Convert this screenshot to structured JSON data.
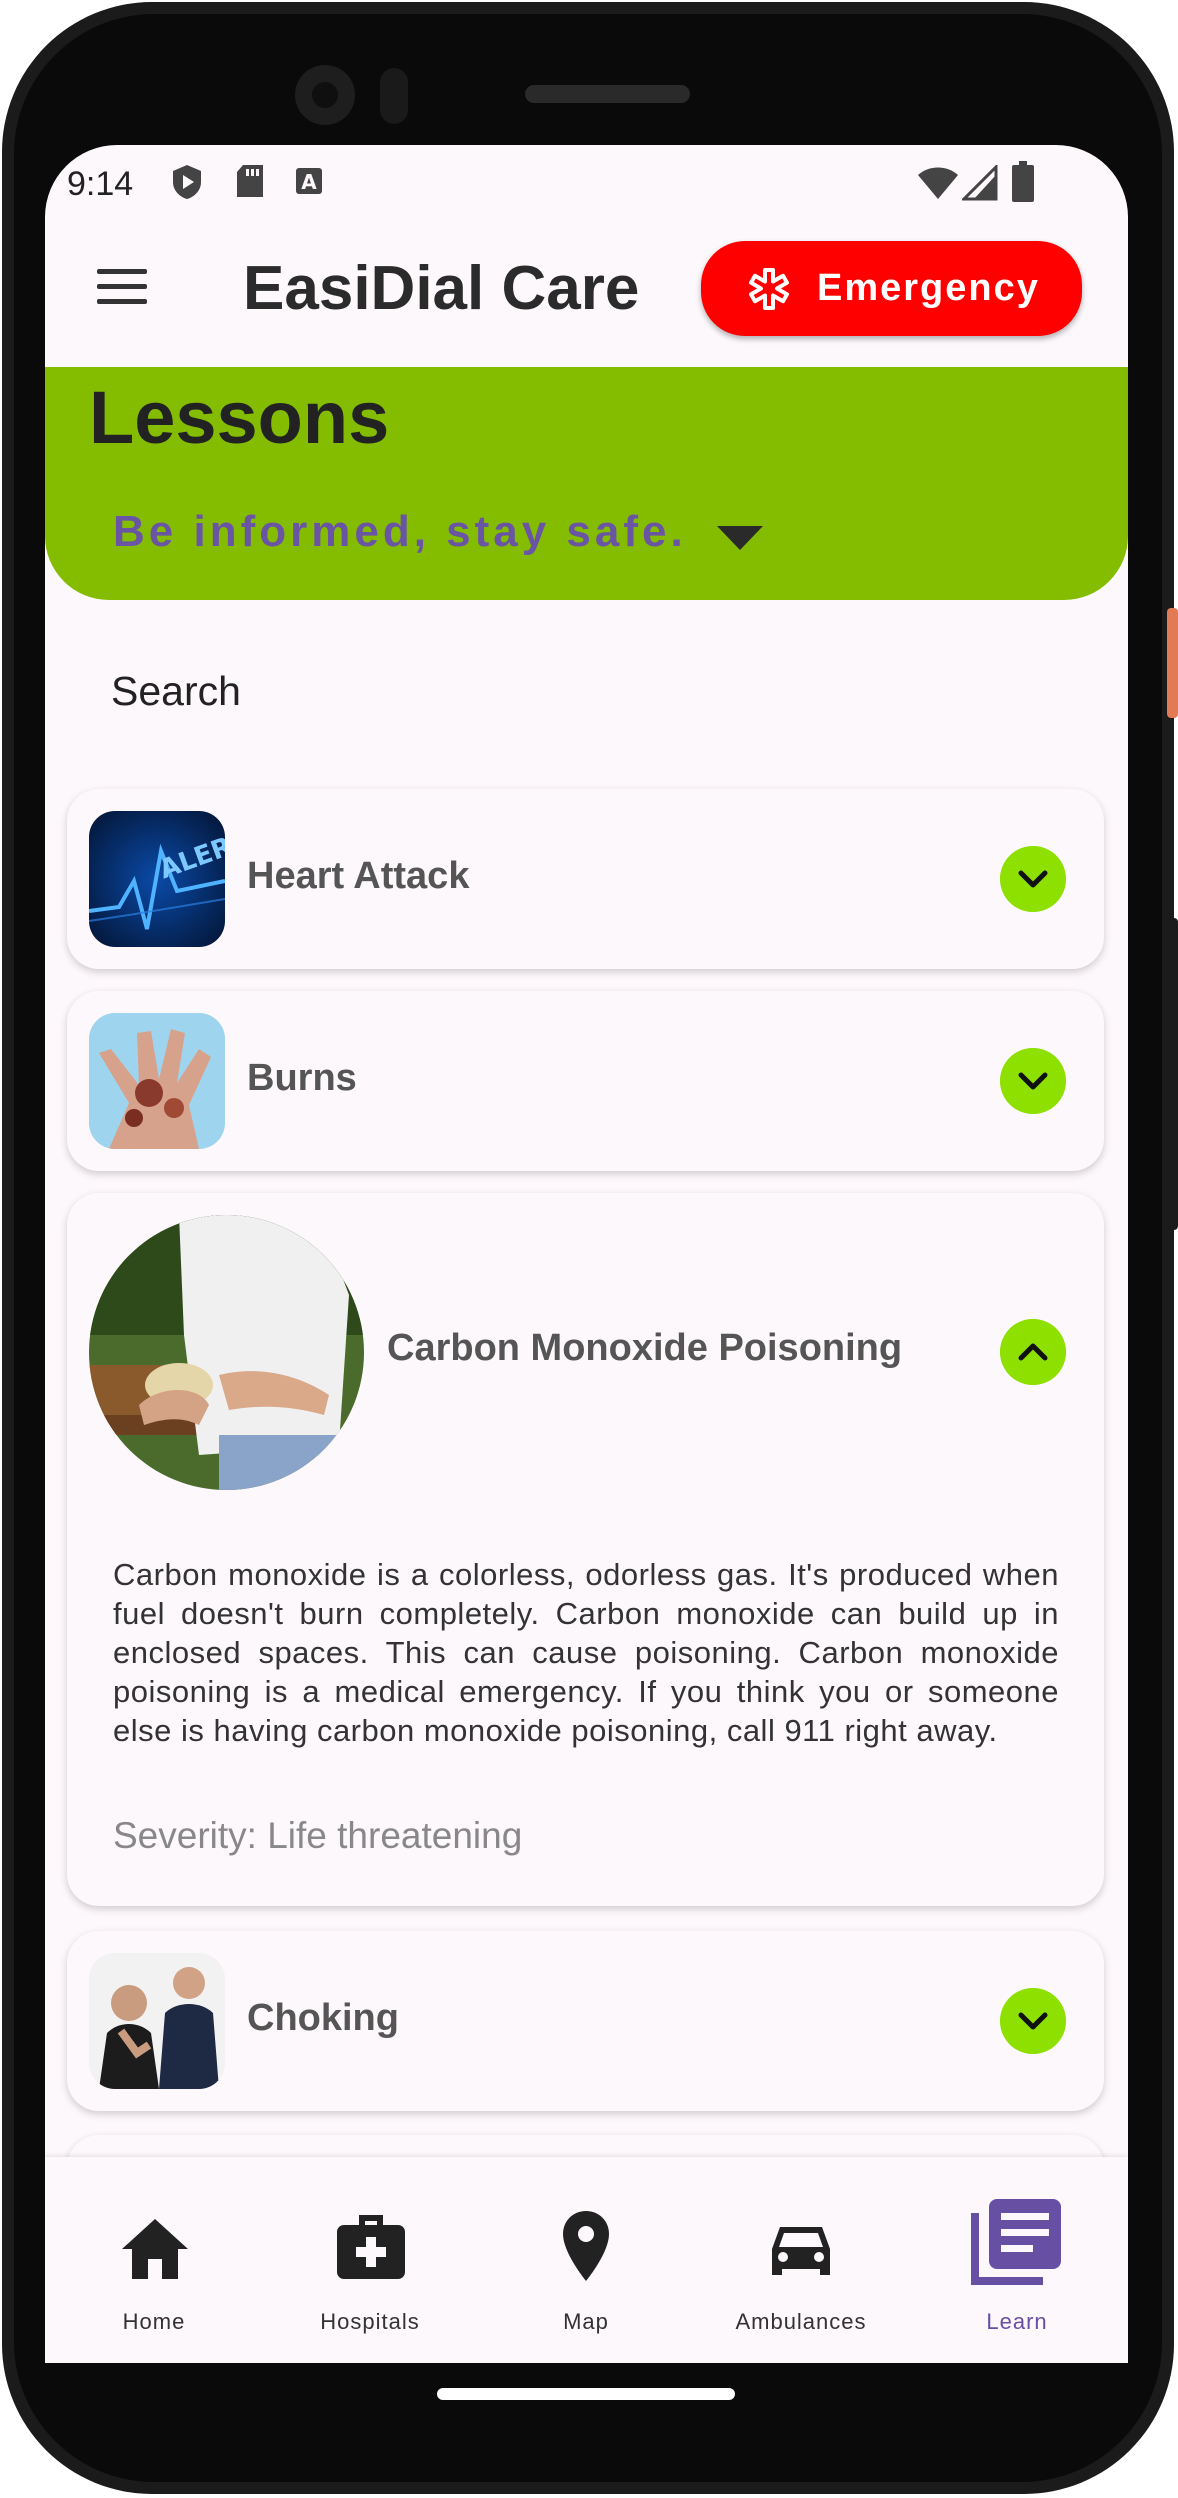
{
  "status_bar": {
    "time": "9:14"
  },
  "app_bar": {
    "title": "EasiDial Care",
    "emergency_label": "Emergency"
  },
  "header": {
    "title": "Lessons",
    "subtitle": "Be informed, stay safe."
  },
  "search": {
    "placeholder": "Search"
  },
  "lessons": [
    {
      "title": "Heart Attack",
      "image": "alert-pulse-image"
    },
    {
      "title": "Burns",
      "image": "burned-hand-image"
    },
    {
      "title": "Carbon Monoxide Poisoning",
      "image": "woman-eating-image",
      "description": "Carbon monoxide is a colorless, odorless gas. It's produced when fuel doesn't burn completely. Carbon monoxide can build up in enclosed spaces. This can cause poisoning. Carbon monoxide poisoning is a medical emergency. If you think you or someone else is having carbon monoxide poisoning, call 911 right away.",
      "severity": "Severity: Life threatening"
    },
    {
      "title": "Choking",
      "image": "choking-people-image"
    }
  ],
  "bottom_nav": [
    {
      "label": "Home",
      "icon": "home-icon"
    },
    {
      "label": "Hospitals",
      "icon": "medical-kit-icon"
    },
    {
      "label": "Map",
      "icon": "map-pin-icon"
    },
    {
      "label": "Ambulances",
      "icon": "car-icon"
    },
    {
      "label": "Learn",
      "icon": "article-icon",
      "active": true
    }
  ],
  "colors": {
    "accent_green": "#84bd00",
    "emergency_red": "#ff0000",
    "active_nav": "#6750a4",
    "chevron_green": "#8ee000"
  }
}
